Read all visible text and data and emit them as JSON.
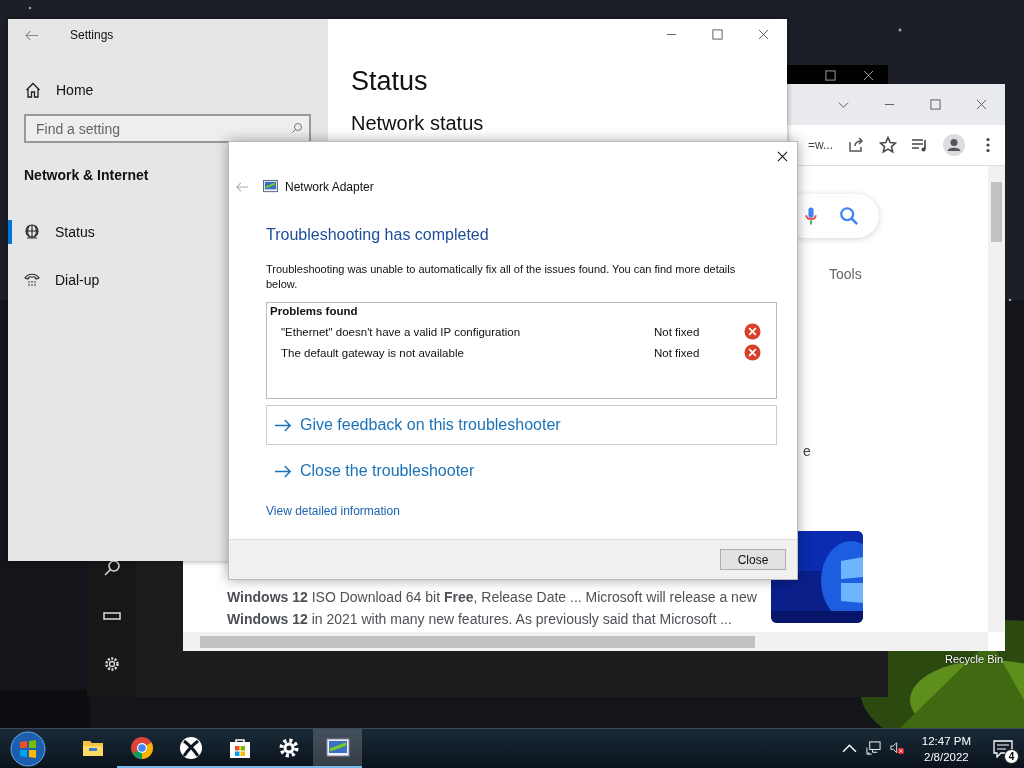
{
  "desktop": {
    "icons": [
      {
        "label": "Recycle Bin"
      }
    ]
  },
  "browser": {
    "address_fragment": "=w...",
    "tools_tab": "Tools",
    "cut_text": "e",
    "result": {
      "snippet": "**Windows 12** ISO Download 64 bit **Free**, Release Date ... Microsoft will release a new **Windows 12** in 2021 with many new features. As previously said that Microsoft ..."
    }
  },
  "settings": {
    "title": "Settings",
    "home": "Home",
    "search": {
      "placeholder": "Find a setting"
    },
    "section": "Network & Internet",
    "nav": [
      {
        "label": "Status",
        "kind": "globe",
        "selected": true
      },
      {
        "label": "Dial-up",
        "kind": "phone",
        "selected": false
      }
    ],
    "page_title": "Status",
    "subheading": "Network status"
  },
  "dialog": {
    "title": "Network Adapter",
    "heading": "Troubleshooting has completed",
    "message": "Troubleshooting was unable to automatically fix all of the issues found. You can find more details below.",
    "problems": {
      "title": "Problems found",
      "items": [
        {
          "text": "\"Ethernet\" doesn't have a valid IP configuration",
          "status": "Not fixed",
          "fixed": false
        },
        {
          "text": "The default gateway is not available",
          "status": "Not fixed",
          "fixed": false
        }
      ]
    },
    "links": [
      {
        "label": "Give feedback on this troubleshooter",
        "boxed": true
      },
      {
        "label": "Close the troubleshooter",
        "boxed": false
      }
    ],
    "details_link": "View detailed information",
    "buttons": [
      "Close"
    ]
  },
  "taskbar": {
    "apps": [
      {
        "kind": "explorer",
        "running": false,
        "selected": false
      },
      {
        "kind": "chrome",
        "running": true,
        "selected": false
      },
      {
        "kind": "xbox",
        "running": true,
        "selected": false
      },
      {
        "kind": "store",
        "running": true,
        "selected": false
      },
      {
        "kind": "settings",
        "running": true,
        "selected": false
      },
      {
        "kind": "adapter",
        "running": true,
        "selected": true
      }
    ],
    "time": "12:47 PM",
    "date": "2/8/2022",
    "notifications": "4"
  }
}
